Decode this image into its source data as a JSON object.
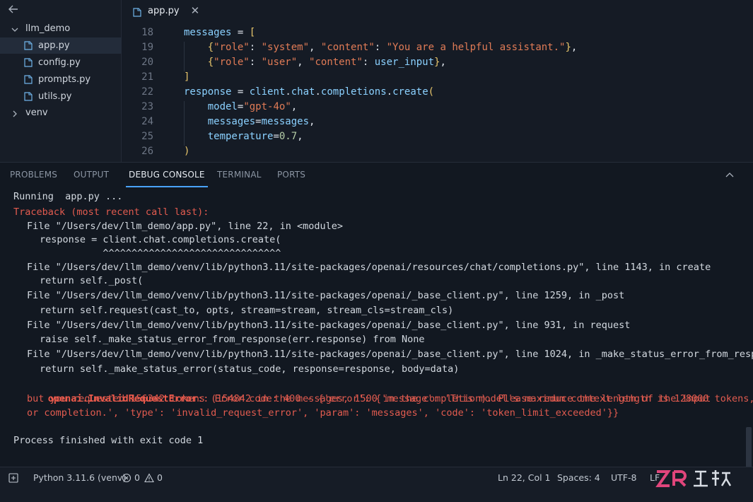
{
  "sidebar": {
    "folder": "llm_demo",
    "files": [
      {
        "label": "app.py",
        "active": true
      },
      {
        "label": "config.py",
        "active": false
      },
      {
        "label": "prompts.py",
        "active": false
      },
      {
        "label": "utils.py",
        "active": false
      }
    ],
    "venv": "venv"
  },
  "editor": {
    "tab_label": "app.py",
    "lines": [
      {
        "num": "18",
        "text": "messages = ["
      },
      {
        "num": "19",
        "text": "    {\"role\": \"system\", \"content\": \"You are a helpful assistant.\"},"
      },
      {
        "num": "20",
        "text": "    {\"role\": \"user\", \"content\": user_input},"
      },
      {
        "num": "21",
        "text": "]"
      },
      {
        "num": "22",
        "text": "response = client.chat.completions.create("
      },
      {
        "num": "23",
        "text": "    model=\"gpt-4o\","
      },
      {
        "num": "24",
        "text": "    messages=messages,"
      },
      {
        "num": "25",
        "text": "    temperature=0.7,"
      },
      {
        "num": "26",
        "text": ")"
      }
    ]
  },
  "panel": {
    "tabs": [
      {
        "label": "PROBLEMS",
        "active": false
      },
      {
        "label": "OUTPUT",
        "active": false
      },
      {
        "label": "DEBUG CONSOLE",
        "active": true
      },
      {
        "label": "TERMINAL",
        "active": false
      },
      {
        "label": "PORTS",
        "active": false
      }
    ],
    "console": [
      {
        "text": "Running  app.py ...",
        "style": "normal",
        "indent": 0
      },
      {
        "text": "Traceback (most recent call last):",
        "style": "err",
        "indent": 0
      },
      {
        "text": "File \"/Users/dev/llm_demo/app.py\", line 22, in <module>",
        "style": "normal",
        "indent": 1
      },
      {
        "text": "response = client.chat.completions.create(",
        "style": "normal",
        "indent": 2
      },
      {
        "text": "           ^^^^^^^^^^^^^^^^^^^^^^^^^^^^^^^",
        "style": "normal",
        "indent": 2
      },
      {
        "text": "File \"/Users/dev/llm_demo/venv/lib/python3.11/site-packages/openai/resources/chat/completions.py\", line 1143, in create",
        "style": "normal",
        "indent": 1
      },
      {
        "text": "return self._post(",
        "style": "normal",
        "indent": 2
      },
      {
        "text": "File \"/Users/dev/llm_demo/venv/lib/python3.11/site-packages/openai/_base_client.py\", line 1259, in _post",
        "style": "normal",
        "indent": 1
      },
      {
        "text": "return self.request(cast_to, opts, stream=stream, stream_cls=stream_cls)",
        "style": "normal",
        "indent": 2
      },
      {
        "text": "File \"/Users/dev/llm_demo/venv/lib/python3.11/site-packages/openai/_base_client.py\", line 931, in request",
        "style": "normal",
        "indent": 1
      },
      {
        "text": "raise self._make_status_error_from_response(err.response) from None",
        "style": "normal",
        "indent": 2
      },
      {
        "text": "File \"/Users/dev/llm_demo/venv/lib/python3.11/site-packages/openai/_base_client.py\", line 1024, in _make_status_error_from_response",
        "style": "normal",
        "indent": 1
      },
      {
        "text": "return self._make_status_error(status_code, response=response, body=data)",
        "style": "normal",
        "indent": 2
      }
    ],
    "error_name": "openai.InvalidRequestError",
    "error_lines": [
      ":: Error code: 400 - {'error': {'message': 'This model's maximum context length is 128000 tokens,",
      "but you requested 156342 tokens (154842 in the messages, 1500 in the completion). Please reduce the length of the input",
      "or completion.', 'type': 'invalid_request_error', 'param': 'messages', 'code': 'token_limit_exceeded'}}"
    ],
    "exit_line": "Process finished with exit code 1"
  },
  "statusbar": {
    "interpreter": "Python 3.11.6 (venv)",
    "errors": "0",
    "warnings": "0",
    "position": "Ln 22, Col 1",
    "spaces": "Spaces: 4",
    "encoding": "UTF-8",
    "eol": "LF"
  },
  "colors": {
    "accent": "#4aa3ff",
    "error": "#e25b4f",
    "string": "#e07b56",
    "variable": "#8bd1ff"
  }
}
